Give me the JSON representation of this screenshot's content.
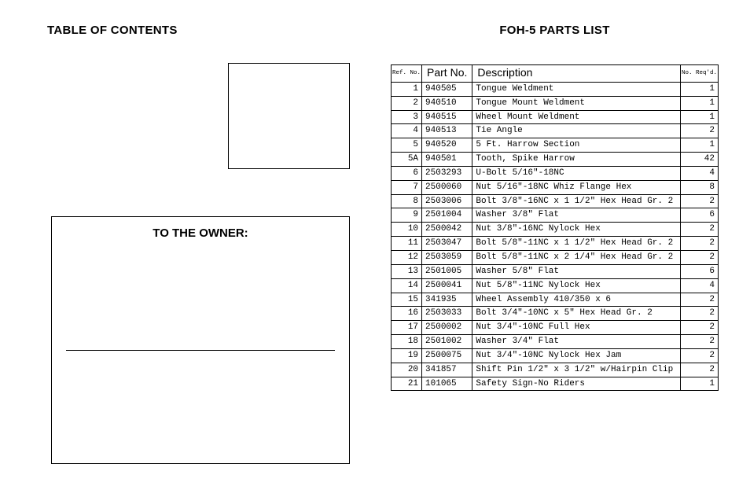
{
  "left": {
    "toc_heading": "TABLE OF CONTENTS",
    "owner_heading": "TO THE OWNER:"
  },
  "right": {
    "parts_heading": "FOH-5 PARTS LIST",
    "table_headers": {
      "ref": "Ref.\nNo.",
      "part": "Part No.",
      "desc": "Description",
      "req": "No.\nReq'd."
    },
    "rows": [
      {
        "ref": "1",
        "part": "940505",
        "desc": "Tongue Weldment",
        "req": "1"
      },
      {
        "ref": "2",
        "part": "940510",
        "desc": "Tongue Mount Weldment",
        "req": "1"
      },
      {
        "ref": "3",
        "part": "940515",
        "desc": "Wheel Mount Weldment",
        "req": "1"
      },
      {
        "ref": "4",
        "part": "940513",
        "desc": "Tie Angle",
        "req": "2"
      },
      {
        "ref": "5",
        "part": "940520",
        "desc": "5 Ft. Harrow Section",
        "req": "1"
      },
      {
        "ref": "5A",
        "part": "940501",
        "desc": "Tooth, Spike Harrow",
        "req": "42"
      },
      {
        "ref": "6",
        "part": "2503293",
        "desc": "U-Bolt 5/16\"-18NC",
        "req": "4"
      },
      {
        "ref": "7",
        "part": "2500060",
        "desc": "Nut 5/16\"-18NC Whiz Flange Hex",
        "req": "8"
      },
      {
        "ref": "8",
        "part": "2503006",
        "desc": "Bolt 3/8\"-16NC x 1 1/2\" Hex Head Gr. 2",
        "req": "2"
      },
      {
        "ref": "9",
        "part": "2501004",
        "desc": "Washer 3/8\" Flat",
        "req": "6"
      },
      {
        "ref": "10",
        "part": "2500042",
        "desc": "Nut 3/8\"-16NC Nylock Hex",
        "req": "2"
      },
      {
        "ref": "11",
        "part": "2503047",
        "desc": "Bolt 5/8\"-11NC x 1 1/2\" Hex Head Gr. 2",
        "req": "2"
      },
      {
        "ref": "12",
        "part": "2503059",
        "desc": "Bolt 5/8\"-11NC x 2 1/4\" Hex Head Gr. 2",
        "req": "2"
      },
      {
        "ref": "13",
        "part": "2501005",
        "desc": "Washer 5/8\" Flat",
        "req": "6"
      },
      {
        "ref": "14",
        "part": "2500041",
        "desc": "Nut 5/8\"-11NC Nylock Hex",
        "req": "4"
      },
      {
        "ref": "15",
        "part": "341935",
        "desc": "Wheel Assembly 410/350 x 6",
        "req": "2"
      },
      {
        "ref": "16",
        "part": "2503033",
        "desc": "Bolt 3/4\"-10NC x 5\" Hex Head Gr. 2",
        "req": "2"
      },
      {
        "ref": "17",
        "part": "2500002",
        "desc": "Nut 3/4\"-10NC Full Hex",
        "req": "2"
      },
      {
        "ref": "18",
        "part": "2501002",
        "desc": "Washer 3/4\" Flat",
        "req": "2"
      },
      {
        "ref": "19",
        "part": "2500075",
        "desc": "Nut 3/4\"-10NC Nylock Hex Jam",
        "req": "2"
      },
      {
        "ref": "20",
        "part": "341857",
        "desc": "Shift Pin 1/2\" x 3 1/2\" w/Hairpin Clip",
        "req": "2"
      },
      {
        "ref": "21",
        "part": "101065",
        "desc": "Safety Sign-No Riders",
        "req": "1"
      }
    ]
  }
}
